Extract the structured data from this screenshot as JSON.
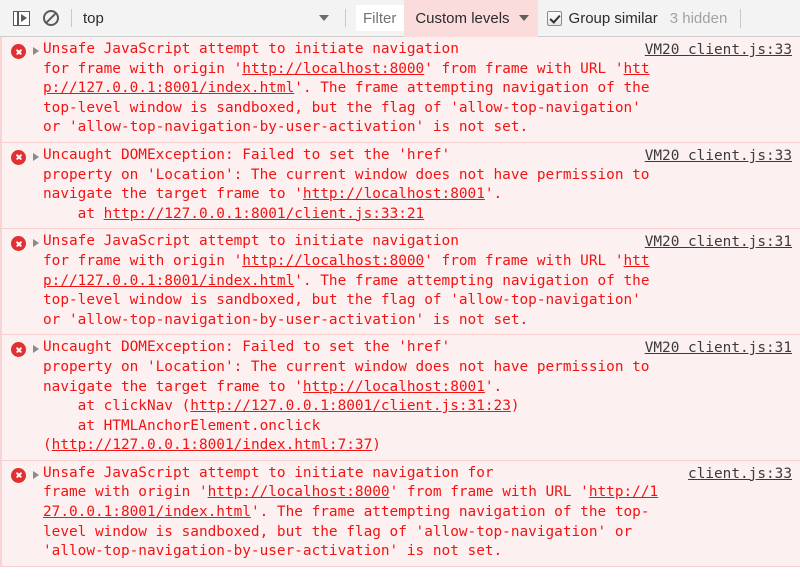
{
  "toolbar": {
    "sidebar_toggle_icon": "console-sidebar-icon",
    "clear_console_icon": "clear-console-icon",
    "context_value": "top",
    "context_caret_icon": "chevron-down-icon",
    "filter_placeholder": "Filter",
    "filter_value": "",
    "levels_label": "Custom levels",
    "levels_caret_icon": "chevron-down-icon",
    "group_similar_label": "Group similar",
    "group_similar_checked": true,
    "hidden_count_label": "3 hidden",
    "levels_active_bg": "#fbdcdc"
  },
  "console": {
    "error_bg": "#fdf0f0",
    "error_text_color": "#f11414",
    "entries": [
      {
        "icon": "error-icon",
        "disclosure": "expand-triangle-icon",
        "source": "VM20 client.js:33",
        "lines": [
          [
            {
              "t": "Unsafe JavaScript attempt to initiate navigation",
              "u": false
            },
            {
              "t": "\nfor frame with origin '",
              "u": false
            },
            {
              "t": "http://localhost:8000",
              "u": true
            },
            {
              "t": "' from frame with URL '",
              "u": false
            },
            {
              "t": "htt\np://127.0.0.1:8001/index.html",
              "u": true
            },
            {
              "t": "'. The frame attempting navigation of the\ntop-level window is sandboxed, but the flag of 'allow-top-navigation'\nor 'allow-top-navigation-by-user-activation' is not set.",
              "u": false
            }
          ]
        ]
      },
      {
        "icon": "error-icon",
        "disclosure": "expand-triangle-icon",
        "source": "VM20 client.js:33",
        "lines": [
          [
            {
              "t": "Uncaught DOMException: Failed to set the 'href'",
              "u": false
            },
            {
              "t": "\nproperty on 'Location': The current window does not have permission to\nnavigate the target frame to '",
              "u": false
            },
            {
              "t": "http://localhost:8001",
              "u": true
            },
            {
              "t": "'.\n    at ",
              "u": false
            },
            {
              "t": "http://127.0.0.1:8001/client.js:33:21",
              "u": true
            }
          ]
        ]
      },
      {
        "icon": "error-icon",
        "disclosure": "expand-triangle-icon",
        "source": "VM20 client.js:31",
        "lines": [
          [
            {
              "t": "Unsafe JavaScript attempt to initiate navigation",
              "u": false
            },
            {
              "t": "\nfor frame with origin '",
              "u": false
            },
            {
              "t": "http://localhost:8000",
              "u": true
            },
            {
              "t": "' from frame with URL '",
              "u": false
            },
            {
              "t": "htt\np://127.0.0.1:8001/index.html",
              "u": true
            },
            {
              "t": "'. The frame attempting navigation of the\ntop-level window is sandboxed, but the flag of 'allow-top-navigation'\nor 'allow-top-navigation-by-user-activation' is not set.",
              "u": false
            }
          ]
        ]
      },
      {
        "icon": "error-icon",
        "disclosure": "expand-triangle-icon",
        "source": "VM20 client.js:31",
        "lines": [
          [
            {
              "t": "Uncaught DOMException: Failed to set the 'href'",
              "u": false
            },
            {
              "t": "\nproperty on 'Location': The current window does not have permission to\nnavigate the target frame to '",
              "u": false
            },
            {
              "t": "http://localhost:8001",
              "u": true
            },
            {
              "t": "'.\n    at clickNav (",
              "u": false
            },
            {
              "t": "http://127.0.0.1:8001/client.js:31:23",
              "u": true
            },
            {
              "t": ")\n    at HTMLAnchorElement.onclick\n(",
              "u": false
            },
            {
              "t": "http://127.0.0.1:8001/index.html:7:37",
              "u": true
            },
            {
              "t": ")",
              "u": false
            }
          ]
        ]
      },
      {
        "icon": "error-icon",
        "disclosure": "expand-triangle-icon",
        "source": "client.js:33",
        "lines": [
          [
            {
              "t": "Unsafe JavaScript attempt to initiate navigation for",
              "u": false
            },
            {
              "t": "\nframe with origin '",
              "u": false
            },
            {
              "t": "http://localhost:8000",
              "u": true
            },
            {
              "t": "' from frame with URL '",
              "u": false
            },
            {
              "t": "http://1\n27.0.0.1:8001/index.html",
              "u": true
            },
            {
              "t": "'. The frame attempting navigation of the top-\nlevel window is sandboxed, but the flag of 'allow-top-navigation' or\n'allow-top-navigation-by-user-activation' is not set.",
              "u": false
            }
          ]
        ]
      }
    ]
  }
}
